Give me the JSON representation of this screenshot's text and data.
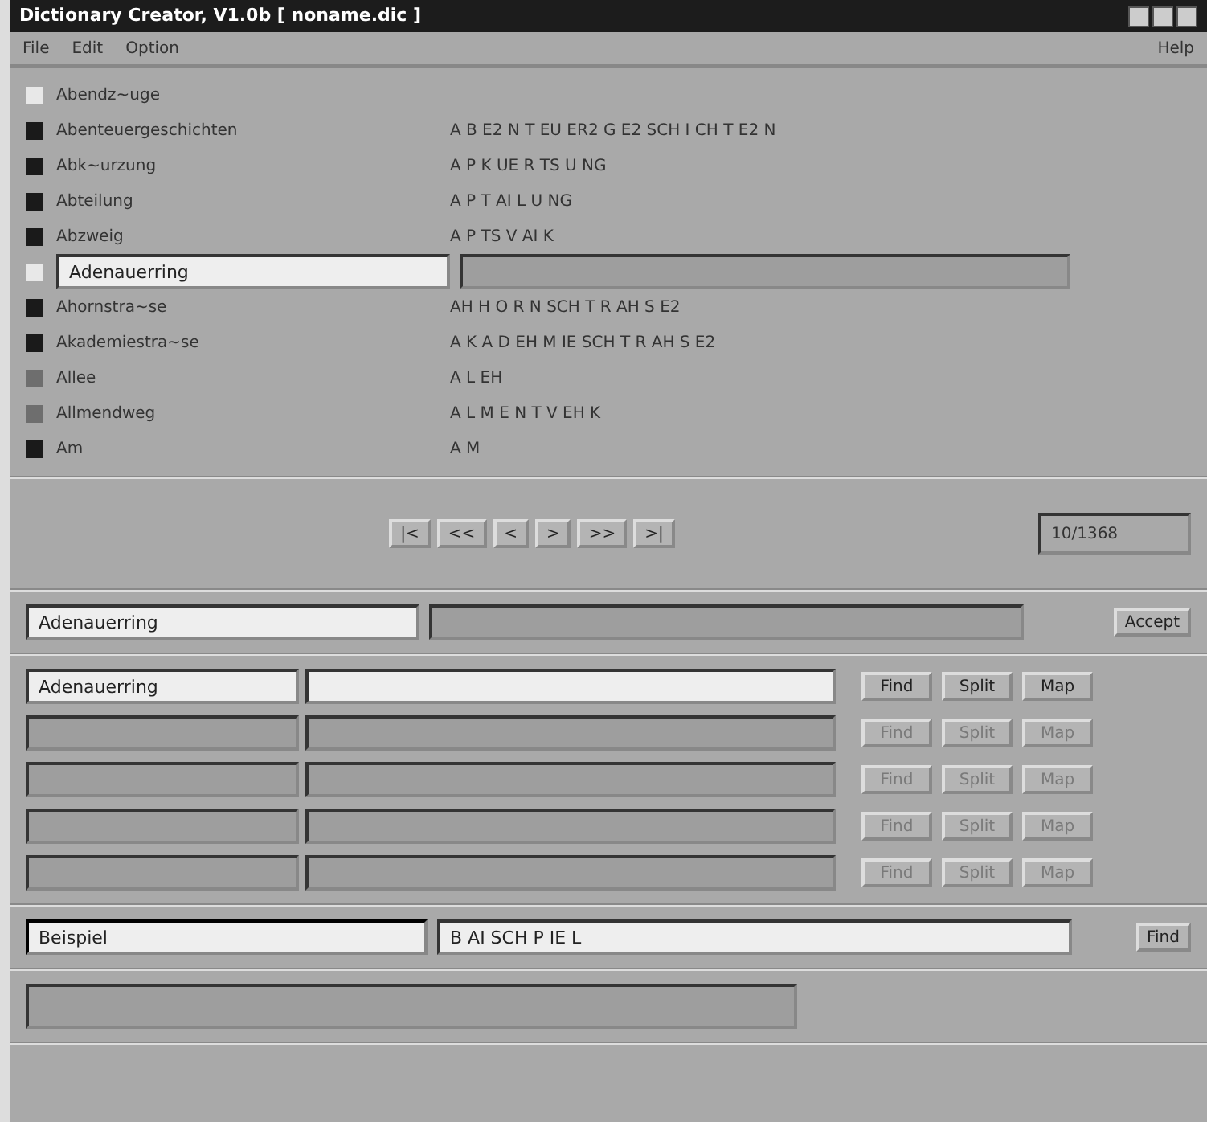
{
  "window": {
    "title": "Dictionary Creator, V1.0b [ noname.dic ]"
  },
  "menu": [
    {
      "label": "File"
    },
    {
      "label": "Edit"
    },
    {
      "label": "Option"
    }
  ],
  "help_menu": {
    "label": "Help"
  },
  "words": [
    {
      "word": "Abendz~uge",
      "color": "#e8e8e8",
      "selected": false
    },
    {
      "word": "Abenteuergeschichten",
      "phonetic": "A B E2 N T EU ER2 G E2 SCH I CH T E2 N",
      "color": "#1a1a1a",
      "selected": false
    },
    {
      "word": "Abk~urzung",
      "phonetic": "A P K UE R TS U NG",
      "color": "#1a1a1a",
      "selected": false
    },
    {
      "word": "Abteilung",
      "phonetic": "A P T AI L U NG",
      "color": "#1a1a1a",
      "selected": false
    },
    {
      "word": "Abzweig",
      "phonetic": "A P TS V AI K",
      "color": "#1a1a1a",
      "selected": false
    },
    {
      "word": "Adenauerring",
      "color": "#e8e8e8",
      "selected": true
    },
    {
      "word": "Ahornstra~se",
      "phonetic": "AH H O R N SCH T R AH S E2",
      "color": "#1a1a1a",
      "selected": false
    },
    {
      "word": "Akademiestra~se",
      "phonetic": "A K A D EH M IE SCH T R AH S E2",
      "color": "#1a1a1a",
      "selected": false
    },
    {
      "word": "Allee",
      "phonetic": "A L EH",
      "color": "#6e6e6e",
      "selected": false
    },
    {
      "word": "Allmendweg",
      "phonetic": "A L M E N T V EH K",
      "color": "#6e6e6e",
      "selected": false
    },
    {
      "word": "Am",
      "phonetic": "A M",
      "color": "#1a1a1a",
      "selected": false
    }
  ],
  "navigation": {
    "buttons": [
      "|<",
      "<<",
      "<",
      ">",
      ">>",
      ">|"
    ],
    "counter": "10/1368"
  },
  "entry": {
    "word": "Adenauerring",
    "button": "Accept"
  },
  "split_rows": [
    {
      "word": "Adenauerring",
      "enabled": true,
      "buttons": [
        "Find",
        "Split",
        "Map"
      ]
    },
    {
      "enabled": false,
      "buttons": [
        "Find",
        "Split",
        "Map"
      ]
    },
    {
      "enabled": false,
      "buttons": [
        "Find",
        "Split",
        "Map"
      ]
    },
    {
      "enabled": false,
      "buttons": [
        "Find",
        "Split",
        "Map"
      ]
    },
    {
      "enabled": false,
      "buttons": [
        "Find",
        "Split",
        "Map"
      ]
    }
  ],
  "test": {
    "word": "Beispiel",
    "phonetic": "B AI SCH P IE L",
    "button": "Find"
  }
}
